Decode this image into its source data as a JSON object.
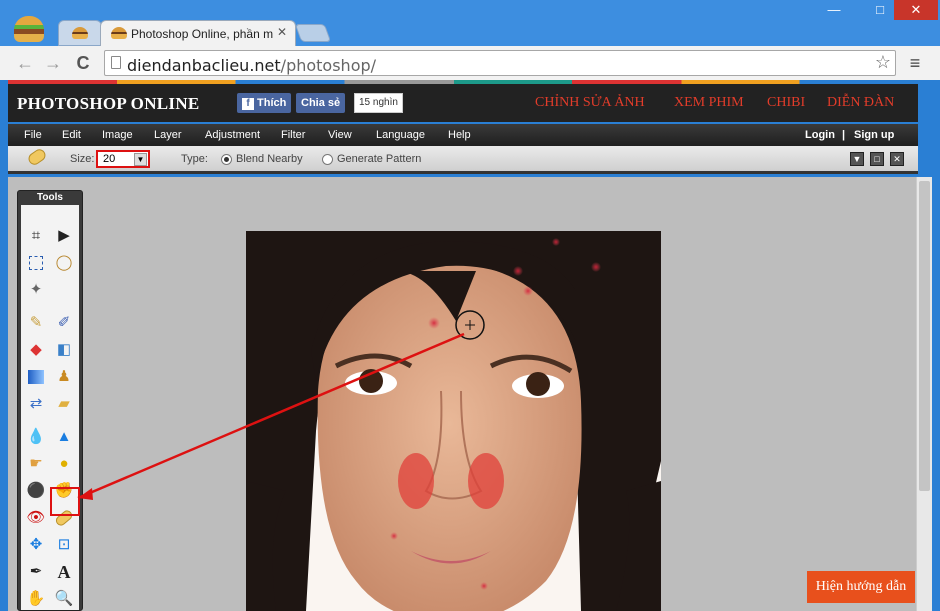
{
  "browser": {
    "tab_title": "Photoshop Online, phần m",
    "url_host": "diendanbaclieu.net",
    "url_path": "/photoshop/",
    "buttons": {
      "minimize": "—",
      "maximize": "□",
      "close": "✕",
      "back": "←",
      "forward": "→",
      "reload": "C",
      "star": "☆",
      "menu": "≡",
      "tab_close": "✕"
    }
  },
  "site": {
    "logo": "PHOTOSHOP ONLINE",
    "fb_like": "Thích",
    "fb_share": "Chia sẻ",
    "fb_count": "15 nghìn",
    "nav": [
      "CHỈNH SỬA ẢNH",
      "XEM PHIM",
      "CHIBI",
      "DIỄN ĐÀN"
    ]
  },
  "app": {
    "menu": [
      "File",
      "Edit",
      "Image",
      "Layer",
      "Adjustment",
      "Filter",
      "View",
      "Language",
      "Help"
    ],
    "login": "Login",
    "separator": "|",
    "signup": "Sign up",
    "options": {
      "size_label": "Size:",
      "size_value": "20",
      "type_label": "Type:",
      "blend_label": "Blend Nearby",
      "pattern_label": "Generate Pattern",
      "selected_type": "Blend Nearby"
    },
    "tools_title": "Tools",
    "help_button": "Hiện hướng dẫn"
  },
  "colors": {
    "accent": "#e23c2a",
    "highlight": "#dd1111",
    "help_bg": "#e8501c"
  }
}
